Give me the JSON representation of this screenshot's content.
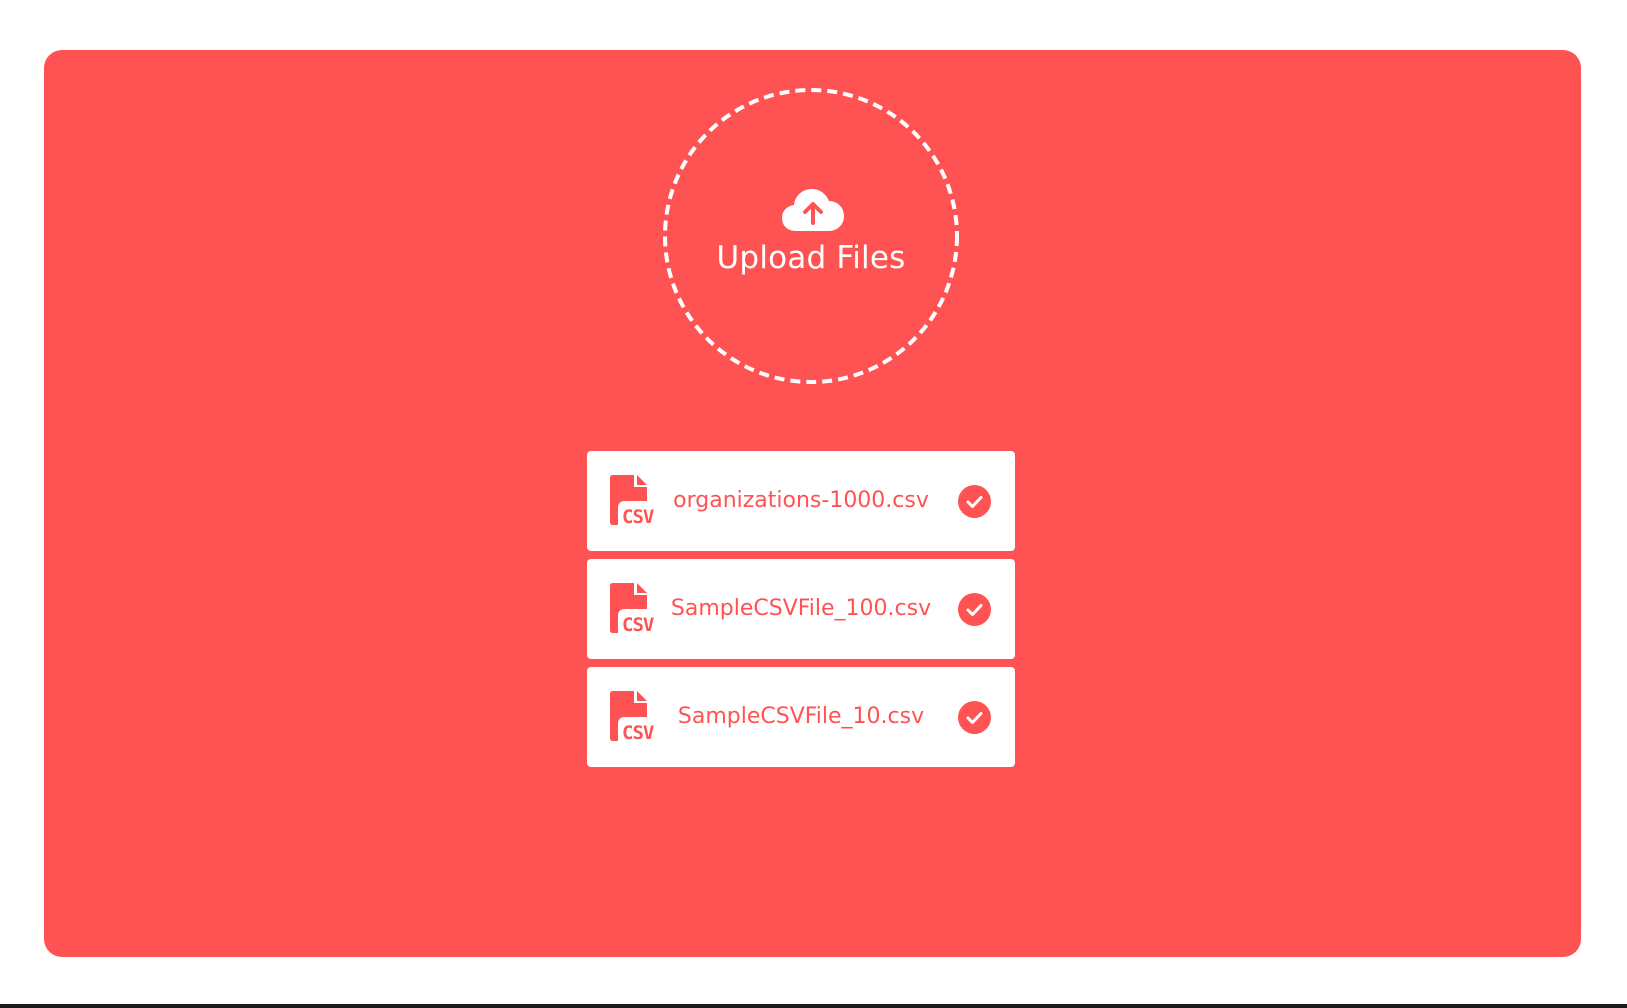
{
  "upload": {
    "label": "Upload Files",
    "icon": "cloud-upload-icon"
  },
  "files": [
    {
      "name": "organizations-1000.csv",
      "icon": "csv-file-icon",
      "status_icon": "check-circle-icon"
    },
    {
      "name": "SampleCSVFile_100.csv",
      "icon": "csv-file-icon",
      "status_icon": "check-circle-icon"
    },
    {
      "name": "SampleCSVFile_10.csv",
      "icon": "csv-file-icon",
      "status_icon": "check-circle-icon"
    }
  ],
  "colors": {
    "accent": "#ff5353",
    "card": "#ffffff",
    "background": "#ffffff"
  }
}
